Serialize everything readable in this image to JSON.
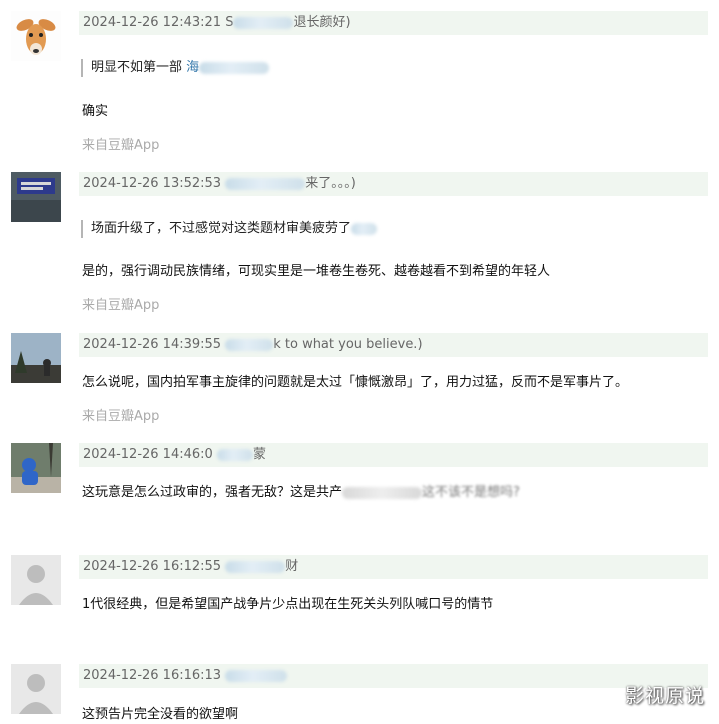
{
  "comments": [
    {
      "time": "2024-12-26 12:43:21",
      "user_visible_start": "S",
      "user_visible_end": "退长颜好)",
      "quote": "明显不如第一部",
      "quote_link": "海",
      "text": "确实",
      "source": "来自豆瓣App"
    },
    {
      "time": "2024-12-26 13:52:53",
      "user_visible_end": "来了。。。)",
      "quote": "场面升级了，不过感觉对这类题材审美疲劳了",
      "text": "是的，强行调动民族情绪，可现实里是一堆卷生卷死、越卷越看不到希望的年轻人",
      "source": "来自豆瓣App"
    },
    {
      "time": "2024-12-26 14:39:55",
      "user_visible_end": "k to what you believe.)",
      "text": "怎么说呢，国内拍军事主旋律的问题就是太过「慷慨激昂」了，用力过猛，反而不是军事片了。",
      "source": "来自豆瓣App"
    },
    {
      "time": "2024-12-26 14:46:0",
      "user_visible_end": "蒙",
      "text_visible_start": "这玩意是怎么过政审的，强者无敌？这是共产",
      "text_visible_end": "这不该不是想吗?"
    },
    {
      "time": "2024-12-26 16:12:55",
      "user_visible_end": "财",
      "text": "1代很经典，但是希望国产战争片少点出现在生死关头列队喊口号的情节"
    },
    {
      "time": "2024-12-26 16:16:13",
      "text": "这预告片完全没看的欲望啊"
    }
  ],
  "watermark": "影视原说"
}
